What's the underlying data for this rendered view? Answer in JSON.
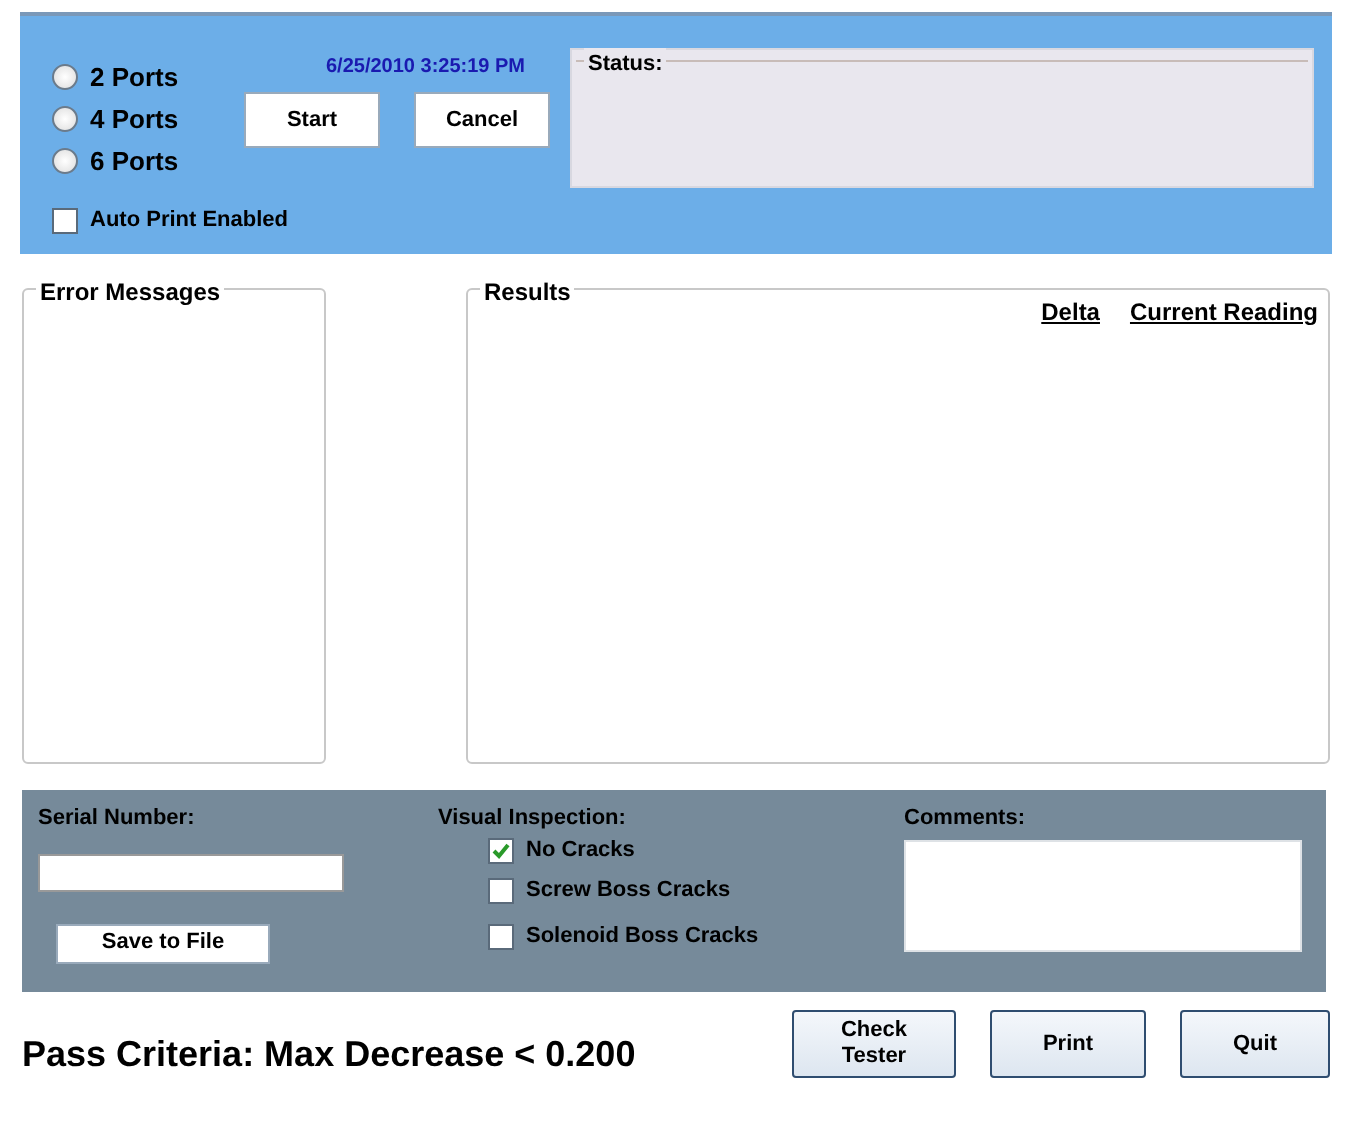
{
  "ports": [
    {
      "label": "2 Ports",
      "selected": false
    },
    {
      "label": "4 Ports",
      "selected": false
    },
    {
      "label": "6 Ports",
      "selected": false
    }
  ],
  "auto_print": {
    "label": "Auto Print Enabled",
    "checked": false
  },
  "timestamp": "6/25/2010 3:25:19 PM",
  "top_buttons": [
    "Start",
    "Cancel"
  ],
  "status": {
    "title": "Status:"
  },
  "error_messages": {
    "title": "Error Messages"
  },
  "results": {
    "title": "Results",
    "columns": [
      "Delta",
      "Current Reading"
    ]
  },
  "serial_number": {
    "label": "Serial Number:"
  },
  "save_button": "Save to File",
  "visual_inspection": {
    "label": "Visual Inspection:",
    "items": [
      {
        "label": "No Cracks",
        "checked": true
      },
      {
        "label": "Screw Boss Cracks",
        "checked": false
      },
      {
        "label": "Solenoid Boss Cracks",
        "checked": false
      }
    ]
  },
  "comments": {
    "label": "Comments:"
  },
  "pass_criteria": "Pass Criteria: Max Decrease < 0.200",
  "bottom_buttons": [
    [
      "Check",
      "Tester"
    ],
    [
      "Print"
    ],
    [
      "Quit"
    ]
  ]
}
